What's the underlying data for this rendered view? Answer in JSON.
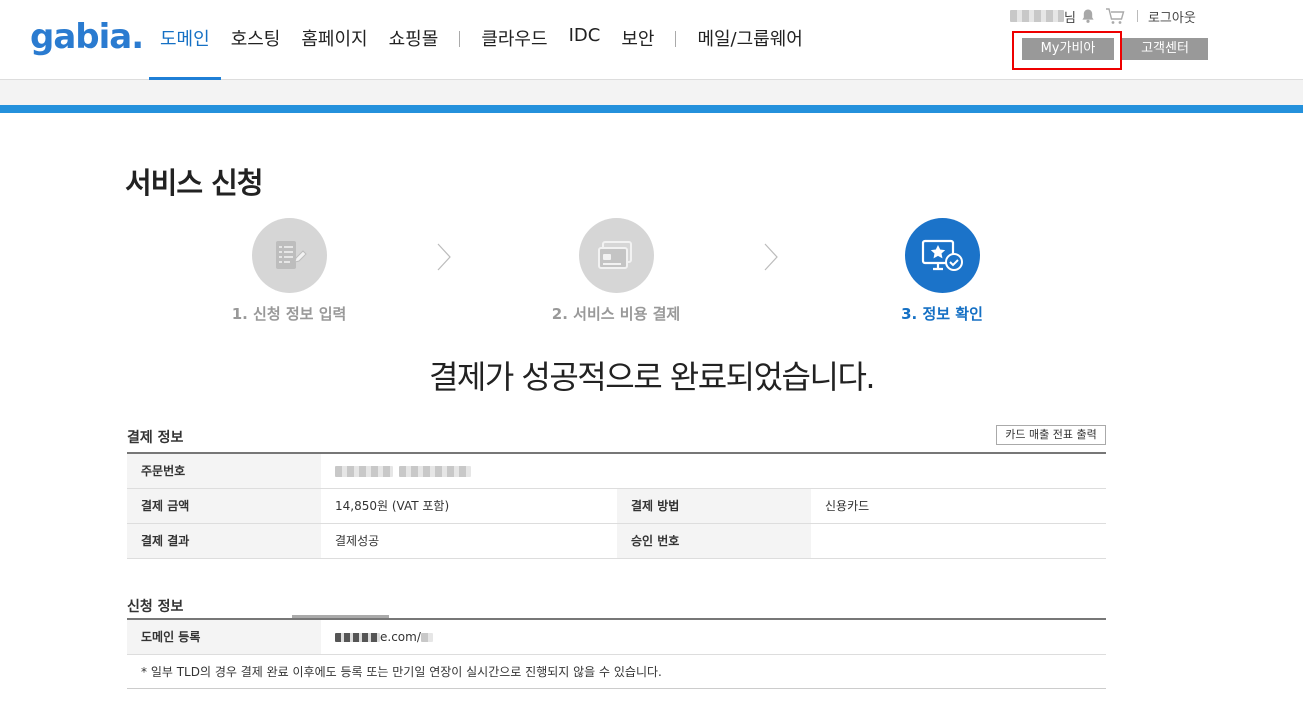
{
  "header": {
    "logo_text": "gabia.",
    "nav_items": [
      {
        "label": "도메인",
        "active": true
      },
      {
        "label": "호스팅"
      },
      {
        "label": "홈페이지"
      },
      {
        "label": "쇼핑몰"
      },
      {
        "label": "클라우드"
      },
      {
        "label": "IDC"
      },
      {
        "label": "보안"
      },
      {
        "label": "메일/그룹웨어"
      }
    ],
    "user_suffix": "님",
    "logout_label": "로그아웃",
    "my_gabia_label": "My가비아",
    "customer_center_label": "고객센터"
  },
  "page": {
    "title": "서비스 신청",
    "steps": [
      {
        "label": "1. 신청 정보 입력",
        "icon": "form-edit-icon",
        "active": false
      },
      {
        "label": "2. 서비스 비용 결제",
        "icon": "credit-card-icon",
        "active": false
      },
      {
        "label": "3. 정보 확인",
        "icon": "monitor-check-icon",
        "active": true
      }
    ],
    "complete_message": "결제가 성공적으로 완료되었습니다."
  },
  "payment_info": {
    "section_title": "결제 정보",
    "print_button_label": "카드 매출 전표 출력",
    "order_number_label": "주문번호",
    "amount_label": "결제 금액",
    "amount_value": "14,850원 (VAT 포함)",
    "method_label": "결제 방법",
    "method_value": "신용카드",
    "result_label": "결제 결과",
    "result_value": "결제성공",
    "approval_label": "승인 번호",
    "approval_value": ""
  },
  "application_info": {
    "section_title": "신청 정보",
    "domain_label": "도메인 등록",
    "domain_value": "e.com/",
    "notice": "* 일부 TLD의 경우 결제 완료 이후에도 등록 또는 만기일 연장이 실시간으로 진행되지 않을 수 있습니다."
  },
  "colors": {
    "brand_blue": "#1f7fd6",
    "step_active": "#1b73c9",
    "step_inactive": "#d6d6d6",
    "highlight_red": "#e00000"
  }
}
